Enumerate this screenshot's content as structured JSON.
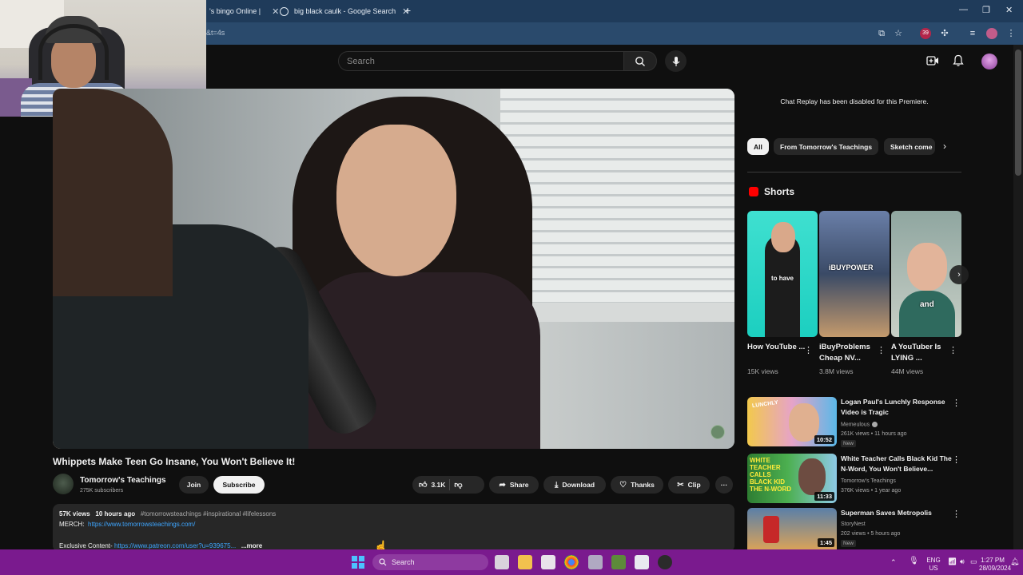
{
  "browser": {
    "tabs": [
      {
        "title": "'s bingo Online |"
      },
      {
        "title": "big black caulk - Google Search"
      }
    ],
    "address_fragment": "&t=4s",
    "ext_badge": "39"
  },
  "youtube": {
    "search_placeholder": "Search",
    "video": {
      "title": "Whippets Make Teen Go Insane, You Won't Believe It!",
      "channel": "Tomorrow's Teachings",
      "subscribers": "275K subscribers",
      "join_label": "Join",
      "subscribe_label": "Subscribe",
      "likes": "3.1K",
      "share_label": "Share",
      "download_label": "Download",
      "thanks_label": "Thanks",
      "clip_label": "Clip",
      "more_label": "···"
    },
    "description": {
      "views": "57K views",
      "age": "10 hours ago",
      "hashtags": "#tomorrowsteachings #inspirational #lifelessons",
      "merch_label": "MERCH:",
      "merch_url": "https://www.tomorrowsteachings.com/",
      "exclusive_label": "Exclusive Content-",
      "exclusive_url": "https://www.patreon.com/user?u=939675...",
      "more_label": "...more"
    },
    "chat_note": "Chat Replay has been disabled for this Premiere.",
    "chips": [
      "All",
      "From Tomorrow's Teachings",
      "Sketch come"
    ],
    "shorts": {
      "heading": "Shorts",
      "items": [
        {
          "caption": "to have",
          "title": "How YouTube ...",
          "views": "15K views"
        },
        {
          "caption": "iBUYPOWER",
          "title": "iBuyProblems Cheap NV...",
          "views": "3.8M views"
        },
        {
          "caption": "and",
          "title": "A YouTuber Is LYING ...",
          "views": "44M views"
        }
      ]
    },
    "recommendations": [
      {
        "title": "Logan Paul's Lunchly Response Video is Tragic",
        "channel": "Memeulous",
        "meta": "261K views • 11 hours ago",
        "badge": "New",
        "duration": "10:52",
        "thumb_text": "LUNCHLY"
      },
      {
        "title": "White Teacher Calls Black Kid The N-Word, You Won't Believe...",
        "channel": "Tomorrow's Teachings",
        "meta": "376K views • 1 year ago",
        "badge": "",
        "duration": "11:33",
        "thumb_text": "WHITE TEACHER CALLS BLACK KID THE N-WORD"
      },
      {
        "title": "Superman Saves Metropolis",
        "channel": "StoryNest",
        "meta": "202 views • 5 hours ago",
        "badge": "New",
        "duration": "1:45",
        "thumb_text": ""
      }
    ]
  },
  "taskbar": {
    "search_label": "Search",
    "lang_top": "ENG",
    "lang_bottom": "US",
    "time": "1:27 PM",
    "date": "28/09/2024"
  }
}
